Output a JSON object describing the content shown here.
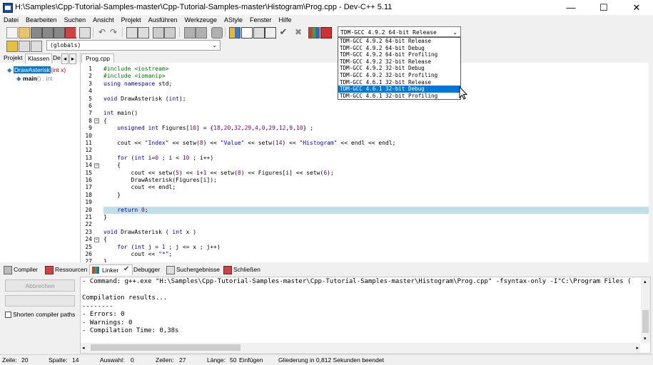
{
  "window": {
    "title": "H:\\Samples\\Cpp-Tutorial-Samples-master\\Cpp-Tutorial-Samples-master\\Histogram\\Prog.cpp - Dev-C++ 5.11",
    "minimize": "—",
    "maximize": "☐",
    "close": "✕"
  },
  "menu": [
    "Datei",
    "Bearbeiten",
    "Suchen",
    "Ansicht",
    "Projekt",
    "Ausführen",
    "Werkzeuge",
    "AStyle",
    "Fenster",
    "Hilfe"
  ],
  "compiler": {
    "selected": "TDM-GCC 4.9.2 64-bit Release",
    "options": [
      "TDM-GCC 4.9.2 64-bit Release",
      "TDM-GCC 4.9.2 64-bit Debug",
      "TDM-GCC 4.9.2 64-bit Profiling",
      "TDM-GCC 4.9.2 32-bit Release",
      "TDM-GCC 4.9.2 32-bit Debug",
      "TDM-GCC 4.9.2 32-bit Profiling",
      "TDM-GCC 4.6.1 32-bit Release",
      "TDM-GCC 4.6.1 32-bit Debug",
      "TDM-GCC 4.6.1 32-bit Profiling"
    ],
    "highlighted_index": 7
  },
  "globals_select": "(globals)",
  "left_tabs": [
    "Projekt",
    "Klassen",
    "De"
  ],
  "tree": [
    {
      "name": "DrawAsterisk",
      "sig": "(int x)"
    },
    {
      "name": "main",
      "sig": "() : int"
    }
  ],
  "editor_tab": "Prog.cpp",
  "code_lines": [
    {
      "n": "1",
      "html": "<span class=\"pp\">#include &lt;iostream&gt;</span>"
    },
    {
      "n": "2",
      "html": "<span class=\"pp\">#include &lt;iomanip&gt;</span>"
    },
    {
      "n": "3",
      "html": "<span class=\"kw\">using namespace</span> std;"
    },
    {
      "n": "4",
      "html": ""
    },
    {
      "n": "5",
      "html": "<span class=\"kw\">void</span> DrawAsterisk (<span class=\"kw\">int</span>);"
    },
    {
      "n": "6",
      "html": ""
    },
    {
      "n": "7",
      "html": "<span class=\"kw\">int</span> main()"
    },
    {
      "n": "8",
      "html": "{",
      "fold": true
    },
    {
      "n": "9",
      "html": "    <span class=\"kw\">unsigned int</span> Figures[<span class=\"num\">10</span>] = {<span class=\"num\">18</span>,<span class=\"num\">20</span>,<span class=\"num\">32</span>,<span class=\"num\">29</span>,<span class=\"num\">4</span>,<span class=\"num\">0</span>,<span class=\"num\">29</span>,<span class=\"num\">12</span>,<span class=\"num\">9</span>,<span class=\"num\">10</span>} ;"
    },
    {
      "n": "10",
      "html": ""
    },
    {
      "n": "11",
      "html": "    cout &lt;&lt; <span class=\"st\">\"Index\"</span> &lt;&lt; setw(<span class=\"num\">8</span>) &lt;&lt; <span class=\"st\">\"Value\"</span> &lt;&lt; setw(<span class=\"num\">14</span>) &lt;&lt; <span class=\"st\">\"Histogram\"</span> &lt;&lt; endl &lt;&lt; endl;"
    },
    {
      "n": "12",
      "html": ""
    },
    {
      "n": "13",
      "html": "    <span class=\"kw\">for</span> (<span class=\"kw\">int</span> i=<span class=\"num\">0</span> ; i &lt; <span class=\"num\">10</span> ; i++)"
    },
    {
      "n": "14",
      "html": "    {",
      "fold": true
    },
    {
      "n": "15",
      "html": "        cout &lt;&lt; setw(<span class=\"num\">5</span>) &lt;&lt; i+<span class=\"num\">1</span> &lt;&lt; setw(<span class=\"num\">8</span>) &lt;&lt; Figures[i] &lt;&lt; setw(<span class=\"num\">6</span>);"
    },
    {
      "n": "16",
      "html": "        DrawAsterisk(Figures[i]);"
    },
    {
      "n": "17",
      "html": "        cout &lt;&lt; endl;"
    },
    {
      "n": "18",
      "html": "    }"
    },
    {
      "n": "19",
      "html": ""
    },
    {
      "n": "20",
      "html": "    <span class=\"kw\">return</span> <span class=\"num\">0</span>;",
      "highlight": true
    },
    {
      "n": "21",
      "html": "}"
    },
    {
      "n": "22",
      "html": ""
    },
    {
      "n": "23",
      "html": "<span class=\"kw\">void</span> DrawAsterisk ( <span class=\"kw\">int</span> x )"
    },
    {
      "n": "24",
      "html": "{",
      "fold": true
    },
    {
      "n": "25",
      "html": "    <span class=\"kw\">for</span> (<span class=\"kw\">int</span> j = <span class=\"num\">1</span> ; j &lt;= x ; j++)"
    },
    {
      "n": "26",
      "html": "        cout &lt;&lt; <span class=\"st\">\"*\"</span>;"
    },
    {
      "n": "27",
      "html": "}"
    }
  ],
  "bottom_tabs": [
    "Compiler",
    "Ressourcen",
    "Linker",
    "Debugger",
    "Suchergebnisse",
    "Schließen"
  ],
  "abbrechen_label": "Abbrechen",
  "shorten_label": "Shorten compiler paths",
  "output_lines": [
    "- Command: g++.exe \"H:\\Samples\\Cpp-Tutorial-Samples-master\\Cpp-Tutorial-Samples-master\\Histogram\\Prog.cpp\" -fsyntax-only -I\"C:\\Program Files (",
    "",
    "Compilation results...",
    "--------",
    "- Errors: 0",
    "- Warnings: 0",
    "- Compilation Time: 0,38s"
  ],
  "status": {
    "zeile_label": "Zeile:",
    "zeile": "20",
    "spalte_label": "Spalte:",
    "spalte": "14",
    "auswahl_label": "Auswahl:",
    "auswahl": "0",
    "zeilen_label": "Zeilen:",
    "zeilen": "27",
    "laenge_label": "Länge:",
    "laenge": "50",
    "mode": "Einfügen",
    "message": "Gliederung in 0,812 Sekunden beendet"
  },
  "colors": {
    "highlight_line": "#bfe0e8",
    "selection": "#0078d7",
    "keyword": "#0000c0",
    "preprocessor": "#008000"
  }
}
